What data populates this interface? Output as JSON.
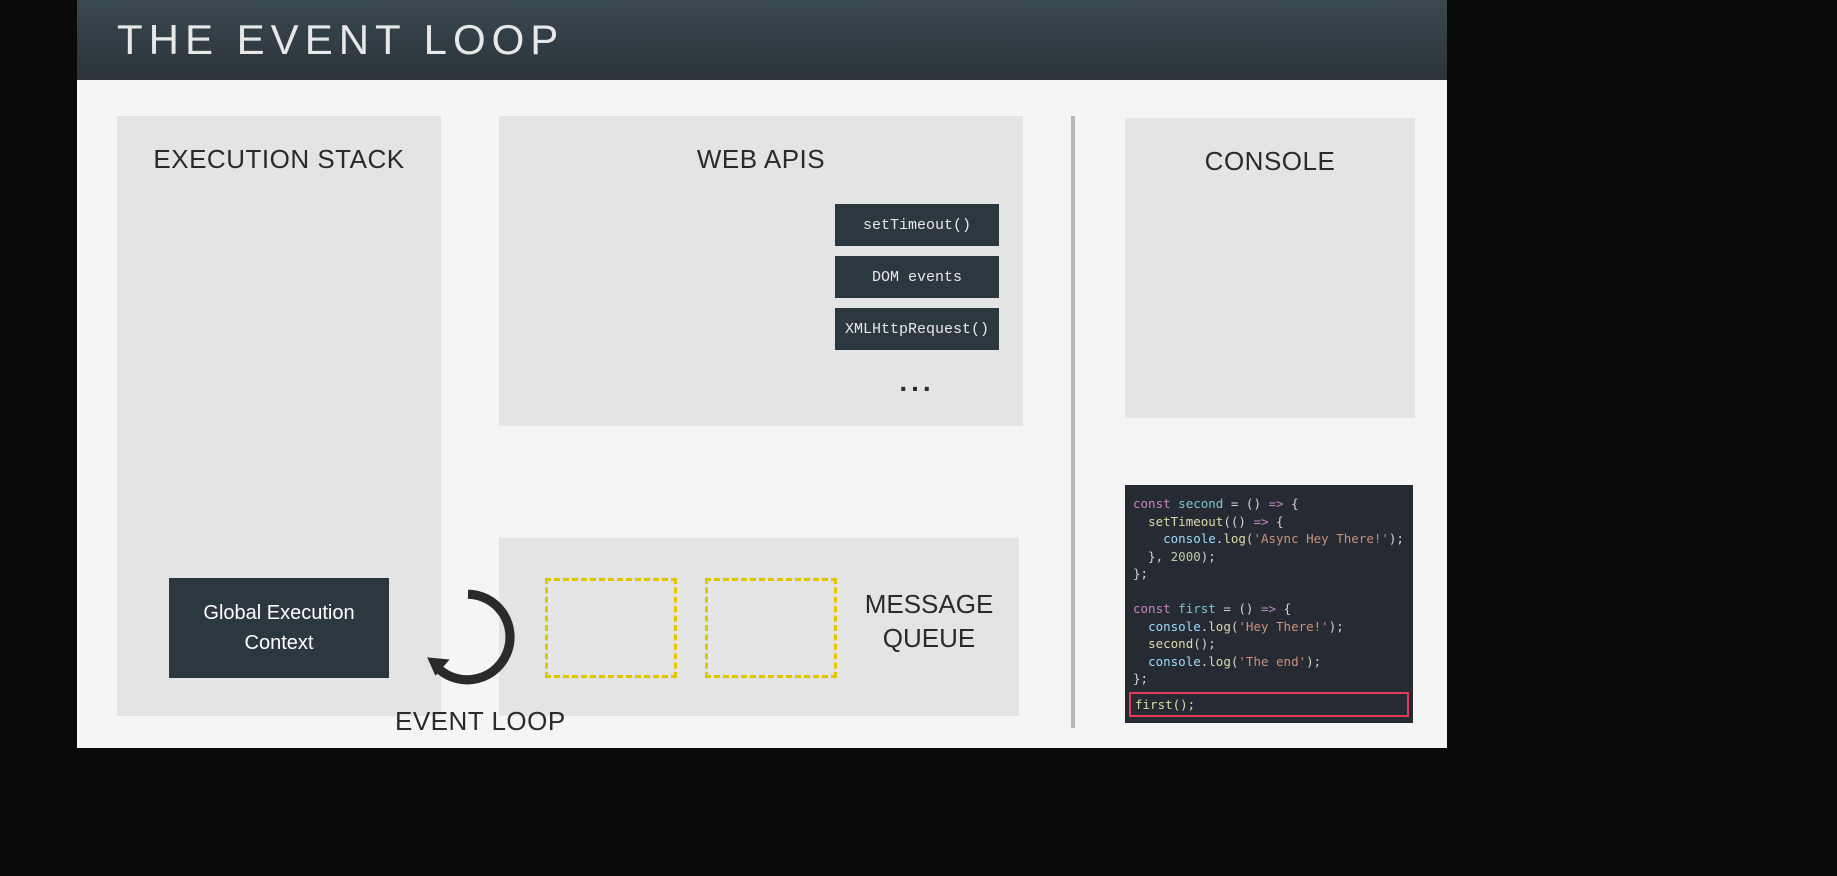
{
  "header": {
    "title": "THE EVENT LOOP"
  },
  "panels": {
    "execStack": {
      "title": "EXECUTION STACK",
      "globalContext": "Global Execution\nContext"
    },
    "webApis": {
      "title": "WEB APIS",
      "items": [
        "setTimeout()",
        "DOM events",
        "XMLHttpRequest()"
      ],
      "ellipsis": "..."
    },
    "messageQueue": {
      "title": "MESSAGE\nQUEUE"
    },
    "eventLoop": {
      "label": "EVENT LOOP"
    },
    "console": {
      "title": "CONSOLE"
    }
  },
  "code": {
    "tokens": {
      "const": "const",
      "second": "second",
      "first": "first",
      "setTimeout": "setTimeout",
      "console": "console",
      "log": "log",
      "strAsync": "'Async Hey There!'",
      "strHey": "'Hey There!'",
      "strEnd": "'The end'",
      "num2000": "2000",
      "firstCall": "first();"
    }
  }
}
